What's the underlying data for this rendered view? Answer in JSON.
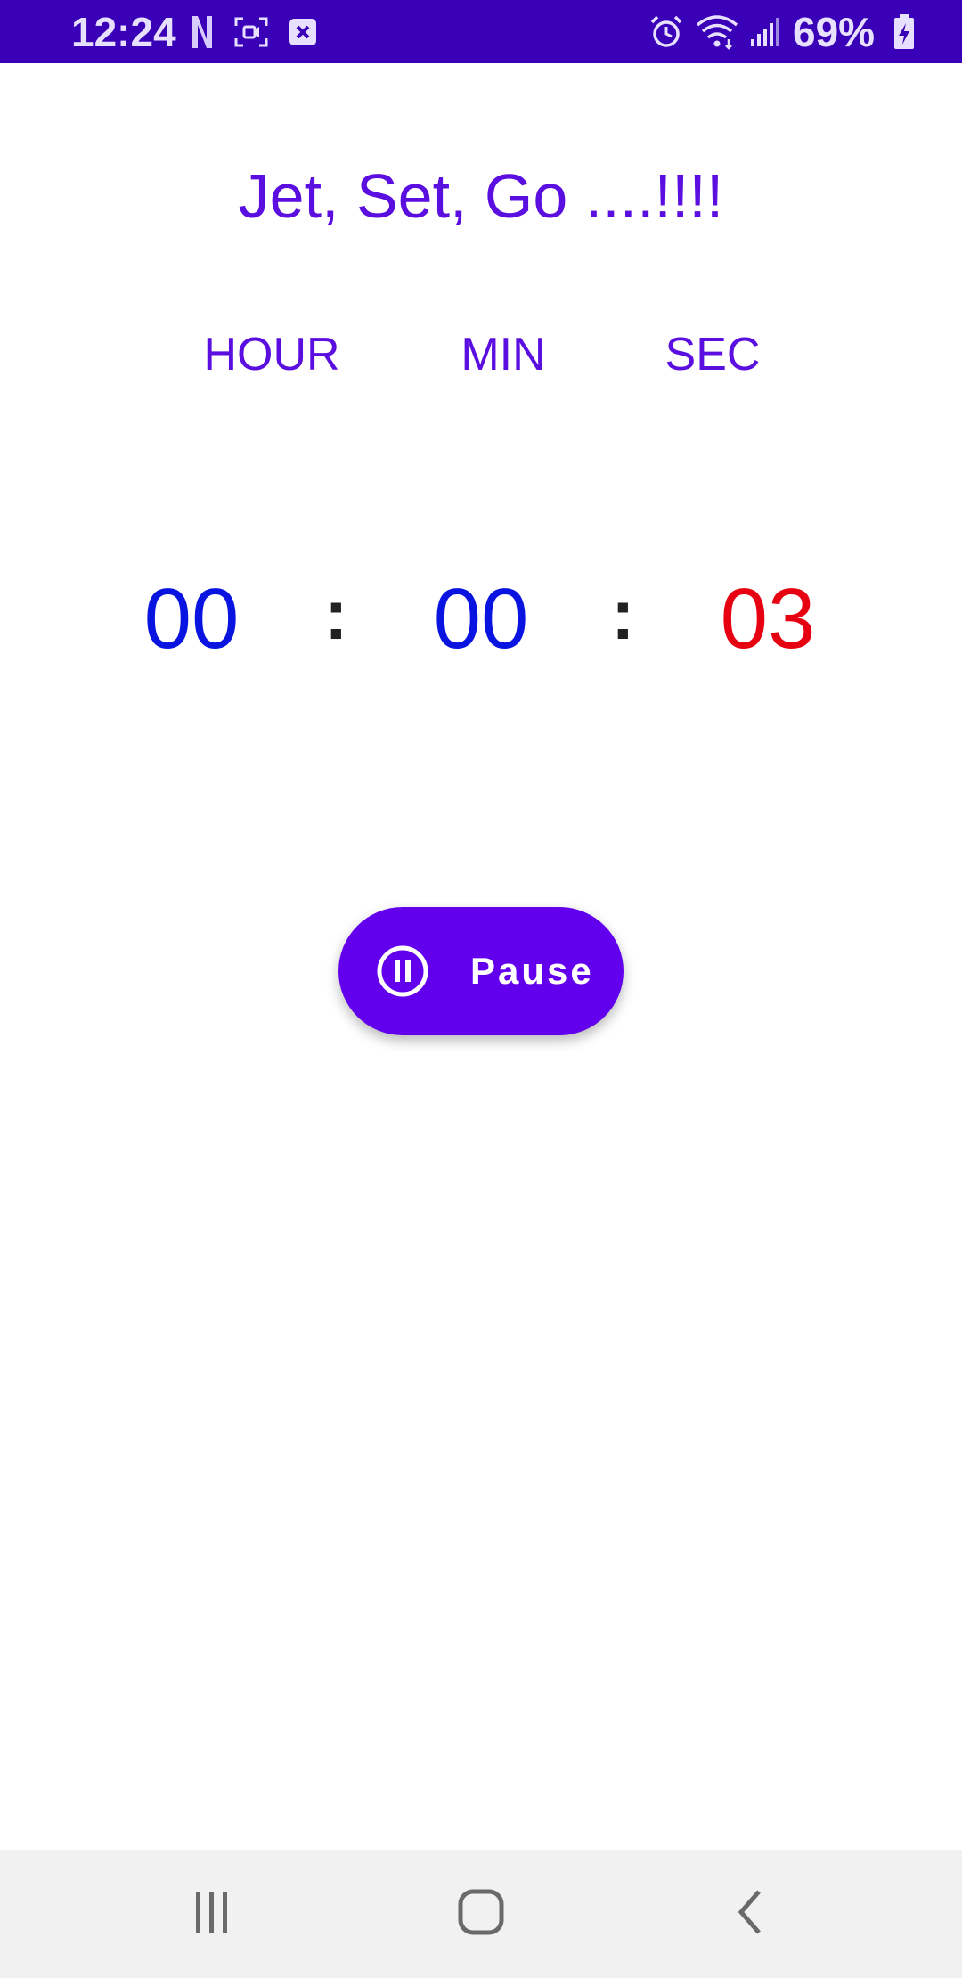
{
  "status_bar": {
    "time": "12:24",
    "battery_percent": "69%",
    "icons": [
      "netflix-icon",
      "screen-record-icon",
      "close-notification-icon",
      "alarm-icon",
      "wifi-icon",
      "signal-icon",
      "battery-charging-icon"
    ],
    "background_color": "#3a00b8"
  },
  "title": "Jet, Set, Go ....!!!!",
  "units": {
    "hour": "HOUR",
    "min": "MIN",
    "sec": "SEC"
  },
  "timer": {
    "hours": "00",
    "minutes": "00",
    "seconds": "03",
    "separator": ":"
  },
  "pause_button": {
    "label": "Pause",
    "icon": "pause-circle-icon",
    "color": "#6200ee"
  },
  "nav_bar": {
    "items": [
      "recent-apps-icon",
      "home-icon",
      "back-icon"
    ]
  },
  "colors": {
    "title": "#5b0ee0",
    "digits": "#0a14e0",
    "seconds": "#e60012"
  }
}
